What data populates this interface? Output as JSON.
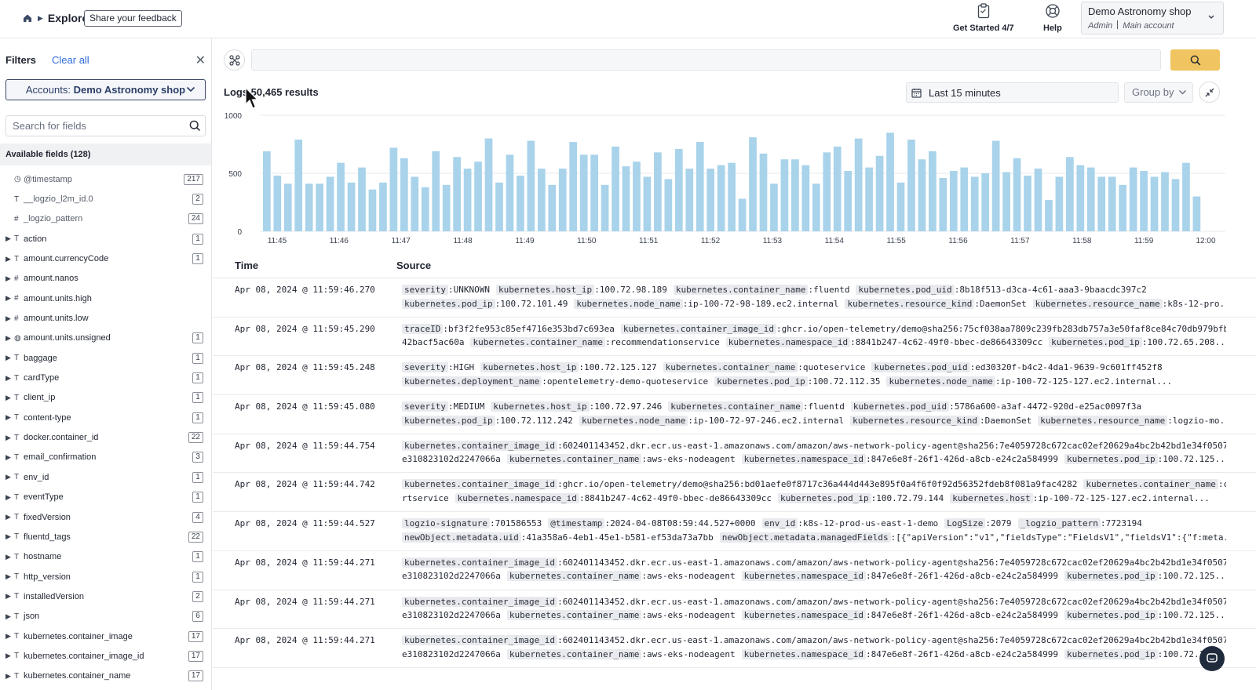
{
  "topbar": {
    "section": "Explore",
    "feedback": "Share your feedback",
    "get_started": "Get Started 4/7",
    "help": "Help",
    "account_name": "Demo Astronomy shop",
    "account_role": "Admin",
    "account_type": "Main account"
  },
  "sidebar": {
    "title": "Filters",
    "clear_all": "Clear all",
    "account_prefix": "Accounts: ",
    "account_value": "Demo Astronomy shop",
    "search_placeholder": "Search for fields",
    "available_fields": "Available fields (128)",
    "fields": [
      {
        "type": "◷",
        "name": "@timestamp",
        "count": "217",
        "caret": false,
        "muted": true
      },
      {
        "type": "T",
        "name": "__logzio_l2m_id.0",
        "count": "2",
        "caret": false,
        "muted": true
      },
      {
        "type": "#",
        "name": "_logzio_pattern",
        "count": "24",
        "caret": false,
        "muted": true
      },
      {
        "type": "T",
        "name": "action",
        "count": "1",
        "caret": true
      },
      {
        "type": "T",
        "name": "amount.currencyCode",
        "count": "1",
        "caret": true
      },
      {
        "type": "#",
        "name": "amount.nanos",
        "count": "",
        "caret": true
      },
      {
        "type": "#",
        "name": "amount.units.high",
        "count": "",
        "caret": true
      },
      {
        "type": "#",
        "name": "amount.units.low",
        "count": "",
        "caret": true
      },
      {
        "type": "◍",
        "name": "amount.units.unsigned",
        "count": "1",
        "caret": true
      },
      {
        "type": "T",
        "name": "baggage",
        "count": "1",
        "caret": true
      },
      {
        "type": "T",
        "name": "cardType",
        "count": "1",
        "caret": true
      },
      {
        "type": "T",
        "name": "client_ip",
        "count": "1",
        "caret": true
      },
      {
        "type": "T",
        "name": "content-type",
        "count": "1",
        "caret": true
      },
      {
        "type": "T",
        "name": "docker.container_id",
        "count": "22",
        "caret": true
      },
      {
        "type": "T",
        "name": "email_confirmation",
        "count": "3",
        "caret": true
      },
      {
        "type": "T",
        "name": "env_id",
        "count": "1",
        "caret": true
      },
      {
        "type": "T",
        "name": "eventType",
        "count": "1",
        "caret": true
      },
      {
        "type": "T",
        "name": "fixedVersion",
        "count": "4",
        "caret": true
      },
      {
        "type": "T",
        "name": "fluentd_tags",
        "count": "22",
        "caret": true
      },
      {
        "type": "T",
        "name": "hostname",
        "count": "1",
        "caret": true
      },
      {
        "type": "T",
        "name": "http_version",
        "count": "1",
        "caret": true
      },
      {
        "type": "T",
        "name": "installedVersion",
        "count": "2",
        "caret": true
      },
      {
        "type": "T",
        "name": "json",
        "count": "6",
        "caret": true
      },
      {
        "type": "T",
        "name": "kubernetes.container_image",
        "count": "17",
        "caret": true
      },
      {
        "type": "T",
        "name": "kubernetes.container_image_id",
        "count": "17",
        "caret": true
      },
      {
        "type": "T",
        "name": "kubernetes.container_name",
        "count": "17",
        "caret": true
      }
    ]
  },
  "main": {
    "results_prefix": "Logs ",
    "results_count": "50,465 results",
    "time_range": "Last 15 minutes",
    "group_by": "Group by",
    "col_time": "Time",
    "col_source": "Source"
  },
  "chart_data": {
    "type": "bar",
    "y_ticks": [
      "1000",
      "500",
      "0"
    ],
    "ylim": [
      0,
      1000
    ],
    "x_ticks": [
      "11:45",
      "11:46",
      "11:47",
      "11:48",
      "11:49",
      "11:50",
      "11:51",
      "11:52",
      "11:53",
      "11:54",
      "11:55",
      "11:56",
      "11:57",
      "11:58",
      "11:59",
      "12:00"
    ],
    "bar_color": "#a8d3ea",
    "values": [
      690,
      480,
      410,
      790,
      410,
      410,
      470,
      590,
      420,
      550,
      360,
      420,
      720,
      630,
      470,
      380,
      690,
      400,
      640,
      540,
      600,
      800,
      420,
      660,
      480,
      780,
      540,
      400,
      540,
      770,
      660,
      660,
      400,
      730,
      560,
      600,
      470,
      680,
      450,
      710,
      540,
      770,
      540,
      570,
      590,
      280,
      810,
      670,
      410,
      620,
      620,
      570,
      410,
      680,
      730,
      520,
      800,
      550,
      650,
      850,
      420,
      790,
      620,
      690,
      460,
      520,
      550,
      470,
      500,
      780,
      510,
      630,
      480,
      540,
      270,
      470,
      640,
      570,
      550,
      470,
      470,
      400,
      550,
      520,
      470,
      510,
      450,
      590,
      300
    ]
  },
  "logs": [
    {
      "time": "Apr 08, 2024 @ 11:59:46.270",
      "lines": [
        [
          [
            "severity",
            "UNKNOWN"
          ],
          [
            "kubernetes.host_ip",
            "100.72.98.189"
          ],
          [
            "kubernetes.container_name",
            "fluentd"
          ],
          [
            "kubernetes.pod_uid",
            "8b18f513-d3ca-4c61-aaa3-9baacdc397c2"
          ]
        ],
        [
          [
            "kubernetes.pod_ip",
            "100.72.101.49"
          ],
          [
            "kubernetes.node_name",
            "ip-100-72-98-189.ec2.internal"
          ],
          [
            "kubernetes.resource_kind",
            "DaemonSet"
          ],
          [
            "kubernetes.resource_name",
            "k8s-12-pro..."
          ]
        ]
      ]
    },
    {
      "time": "Apr 08, 2024 @ 11:59:45.290",
      "lines": [
        [
          [
            "traceID",
            "bf3f2fe953c85ef4716e353bd7c693ea"
          ],
          [
            "kubernetes.container_image_id",
            "ghcr.io/open-telemetry/demo@sha256:75cf038aa7809c239fb283db757a3e50faf8ce84c70db979bfb6"
          ]
        ],
        [
          [
            "",
            "42bacf5ac60a"
          ],
          [
            "kubernetes.container_name",
            "recommendationservice"
          ],
          [
            "kubernetes.namespace_id",
            "8841b247-4c62-49f0-bbec-de86643309cc"
          ],
          [
            "kubernetes.pod_ip",
            "100.72.65.208..."
          ]
        ]
      ]
    },
    {
      "time": "Apr 08, 2024 @ 11:59:45.248",
      "lines": [
        [
          [
            "severity",
            "HIGH"
          ],
          [
            "kubernetes.host_ip",
            "100.72.125.127"
          ],
          [
            "kubernetes.container_name",
            "quoteservice"
          ],
          [
            "kubernetes.pod_uid",
            "ed30320f-b4c2-4da1-9639-9c601ff452f8"
          ]
        ],
        [
          [
            "kubernetes.deployment_name",
            "opentelemetry-demo-quoteservice"
          ],
          [
            "kubernetes.pod_ip",
            "100.72.112.35"
          ],
          [
            "kubernetes.node_name",
            "ip-100-72-125-127.ec2.internal..."
          ]
        ]
      ]
    },
    {
      "time": "Apr 08, 2024 @ 11:59:45.080",
      "lines": [
        [
          [
            "severity",
            "MEDIUM"
          ],
          [
            "kubernetes.host_ip",
            "100.72.97.246"
          ],
          [
            "kubernetes.container_name",
            "fluentd"
          ],
          [
            "kubernetes.pod_uid",
            "5786a600-a3af-4472-920d-e25ac0097f3a"
          ]
        ],
        [
          [
            "kubernetes.pod_ip",
            "100.72.112.242"
          ],
          [
            "kubernetes.node_name",
            "ip-100-72-97-246.ec2.internal"
          ],
          [
            "kubernetes.resource_kind",
            "DaemonSet"
          ],
          [
            "kubernetes.resource_name",
            "logzio-mo..."
          ]
        ]
      ]
    },
    {
      "time": "Apr 08, 2024 @ 11:59:44.754",
      "lines": [
        [
          [
            "kubernetes.container_image_id",
            "602401143452.dkr.ecr.us-east-1.amazonaws.com/amazon/aws-network-policy-agent@sha256:7e4059728c672cac02ef20629a4bc2b42bd1e34f0507d"
          ]
        ],
        [
          [
            "",
            "e310823102d2247066a"
          ],
          [
            "kubernetes.container_name",
            "aws-eks-nodeagent"
          ],
          [
            "kubernetes.namespace_id",
            "847e6e8f-26f1-426d-a8cb-e24c2a584999"
          ],
          [
            "kubernetes.pod_ip",
            "100.72.125..."
          ]
        ]
      ]
    },
    {
      "time": "Apr 08, 2024 @ 11:59:44.742",
      "lines": [
        [
          [
            "kubernetes.container_image_id",
            "ghcr.io/open-telemetry/demo@sha256:bd01aefe0f8717c36a444d443e895f0a4f6f0f92d56352fdeb8f081a9fac4282"
          ],
          [
            "kubernetes.container_name",
            "ca"
          ]
        ],
        [
          [
            "",
            "rtservice"
          ],
          [
            "kubernetes.namespace_id",
            "8841b247-4c62-49f0-bbec-de86643309cc"
          ],
          [
            "kubernetes.pod_ip",
            "100.72.79.144"
          ],
          [
            "kubernetes.host",
            "ip-100-72-125-127.ec2.internal..."
          ]
        ]
      ]
    },
    {
      "time": "Apr 08, 2024 @ 11:59:44.527",
      "lines": [
        [
          [
            "logzio-signature",
            "701586553"
          ],
          [
            "@timestamp",
            "2024-04-08T08:59:44.527+0000"
          ],
          [
            "env_id",
            "k8s-12-prod-us-east-1-demo"
          ],
          [
            "LogSize",
            "2079"
          ],
          [
            "_logzio_pattern",
            "7723194"
          ]
        ],
        [
          [
            "newObject.metadata.uid",
            "41a358a6-4eb1-45e1-b581-ef53da73a7bb"
          ],
          [
            "newObject.metadata.managedFields",
            "[{\"apiVersion\":\"v1\",\"fieldsType\":\"FieldsV1\",\"fieldsV1\":{\"f:meta..."
          ]
        ]
      ]
    },
    {
      "time": "Apr 08, 2024 @ 11:59:44.271",
      "lines": [
        [
          [
            "kubernetes.container_image_id",
            "602401143452.dkr.ecr.us-east-1.amazonaws.com/amazon/aws-network-policy-agent@sha256:7e4059728c672cac02ef20629a4bc2b42bd1e34f0507d"
          ]
        ],
        [
          [
            "",
            "e310823102d2247066a"
          ],
          [
            "kubernetes.container_name",
            "aws-eks-nodeagent"
          ],
          [
            "kubernetes.namespace_id",
            "847e6e8f-26f1-426d-a8cb-e24c2a584999"
          ],
          [
            "kubernetes.pod_ip",
            "100.72.125..."
          ]
        ]
      ]
    },
    {
      "time": "Apr 08, 2024 @ 11:59:44.271",
      "lines": [
        [
          [
            "kubernetes.container_image_id",
            "602401143452.dkr.ecr.us-east-1.amazonaws.com/amazon/aws-network-policy-agent@sha256:7e4059728c672cac02ef20629a4bc2b42bd1e34f0507d"
          ]
        ],
        [
          [
            "",
            "e310823102d2247066a"
          ],
          [
            "kubernetes.container_name",
            "aws-eks-nodeagent"
          ],
          [
            "kubernetes.namespace_id",
            "847e6e8f-26f1-426d-a8cb-e24c2a584999"
          ],
          [
            "kubernetes.pod_ip",
            "100.72.125..."
          ]
        ]
      ]
    },
    {
      "time": "Apr 08, 2024 @ 11:59:44.271",
      "lines": [
        [
          [
            "kubernetes.container_image_id",
            "602401143452.dkr.ecr.us-east-1.amazonaws.com/amazon/aws-network-policy-agent@sha256:7e4059728c672cac02ef20629a4bc2b42bd1e34f0507d"
          ]
        ],
        [
          [
            "",
            "e310823102d2247066a"
          ],
          [
            "kubernetes.container_name",
            "aws-eks-nodeagent"
          ],
          [
            "kubernetes.namespace_id",
            "847e6e8f-26f1-426d-a8cb-e24c2a584999"
          ],
          [
            "kubernetes.pod_ip",
            "100.72.1"
          ]
        ]
      ]
    }
  ]
}
